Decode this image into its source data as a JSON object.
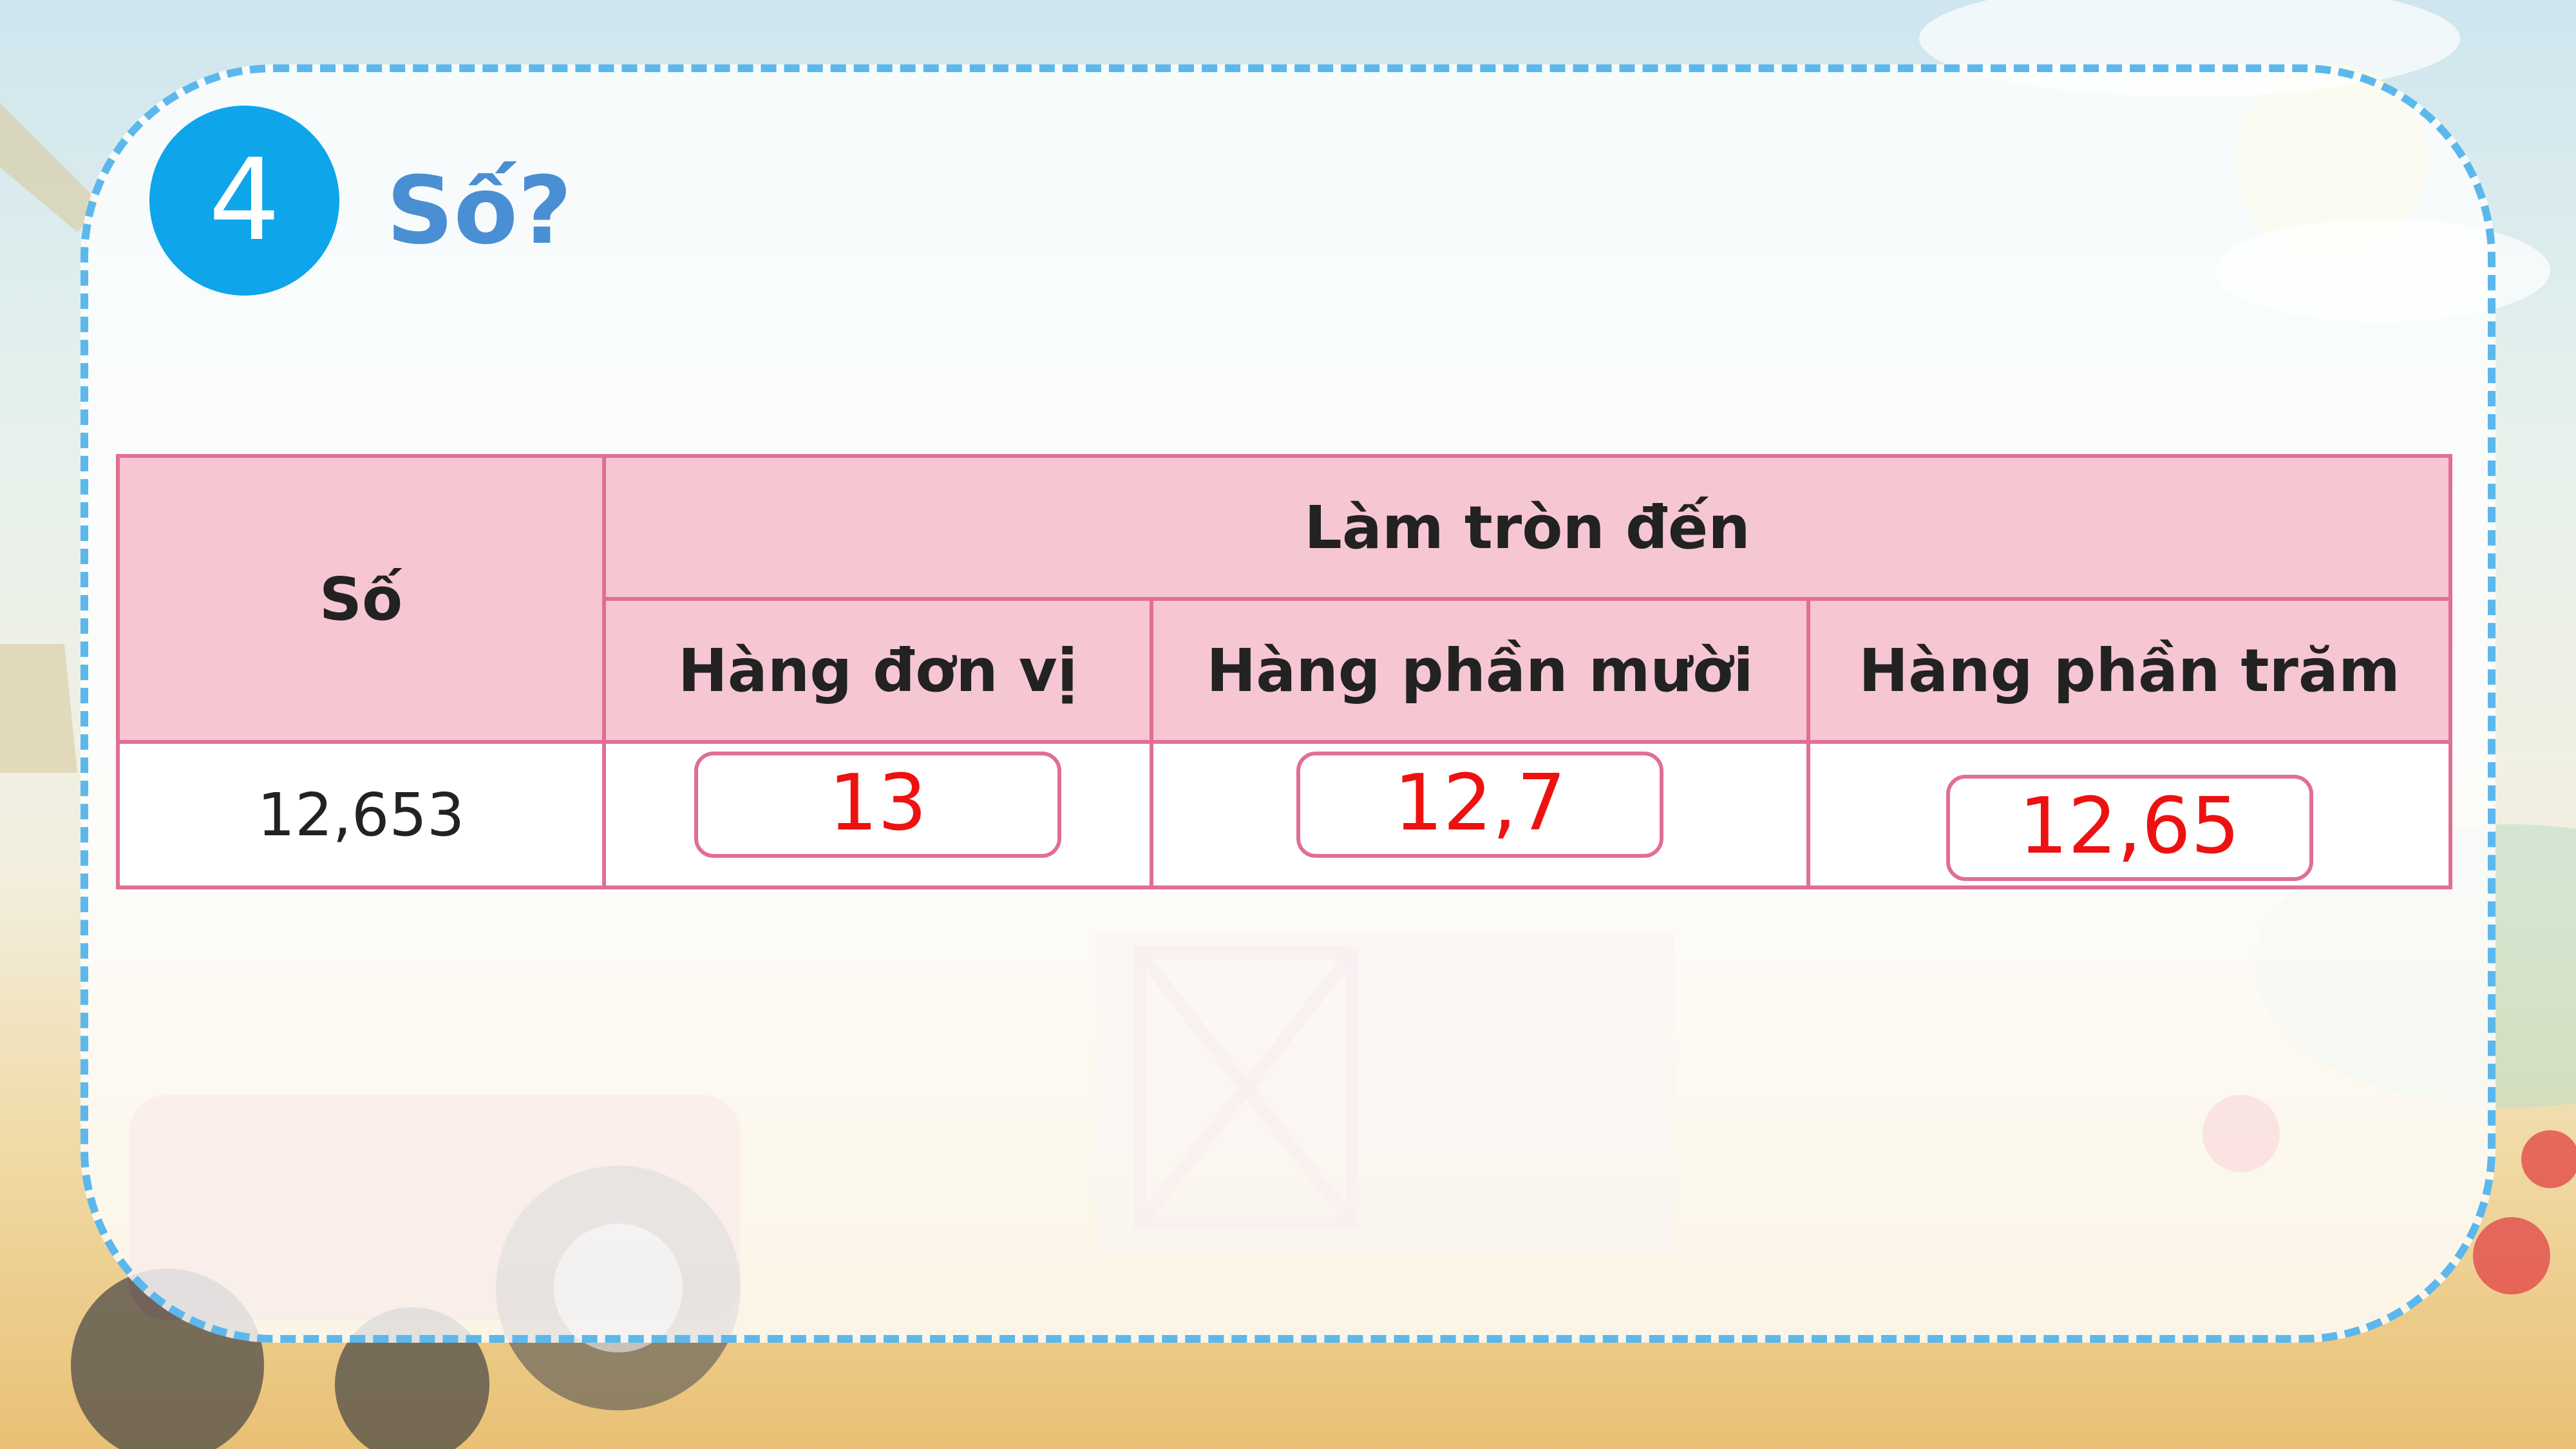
{
  "exercise": {
    "number": "4",
    "title": "Số?"
  },
  "table": {
    "header_number": "Số",
    "header_group": "Làm tròn đến",
    "columns": [
      "Hàng đơn vị",
      "Hàng phần mười",
      "Hàng phần trăm"
    ],
    "row": {
      "number": "12,653",
      "answers": [
        "13",
        "12,7",
        "12,65"
      ]
    }
  },
  "colors": {
    "frame_border": "#5cb8ec",
    "badge": "#0ea5ea",
    "title": "#4a8fd4",
    "header_fill": "#f7c6d3",
    "table_border": "#e06f93",
    "answer_text": "#ee1111"
  }
}
